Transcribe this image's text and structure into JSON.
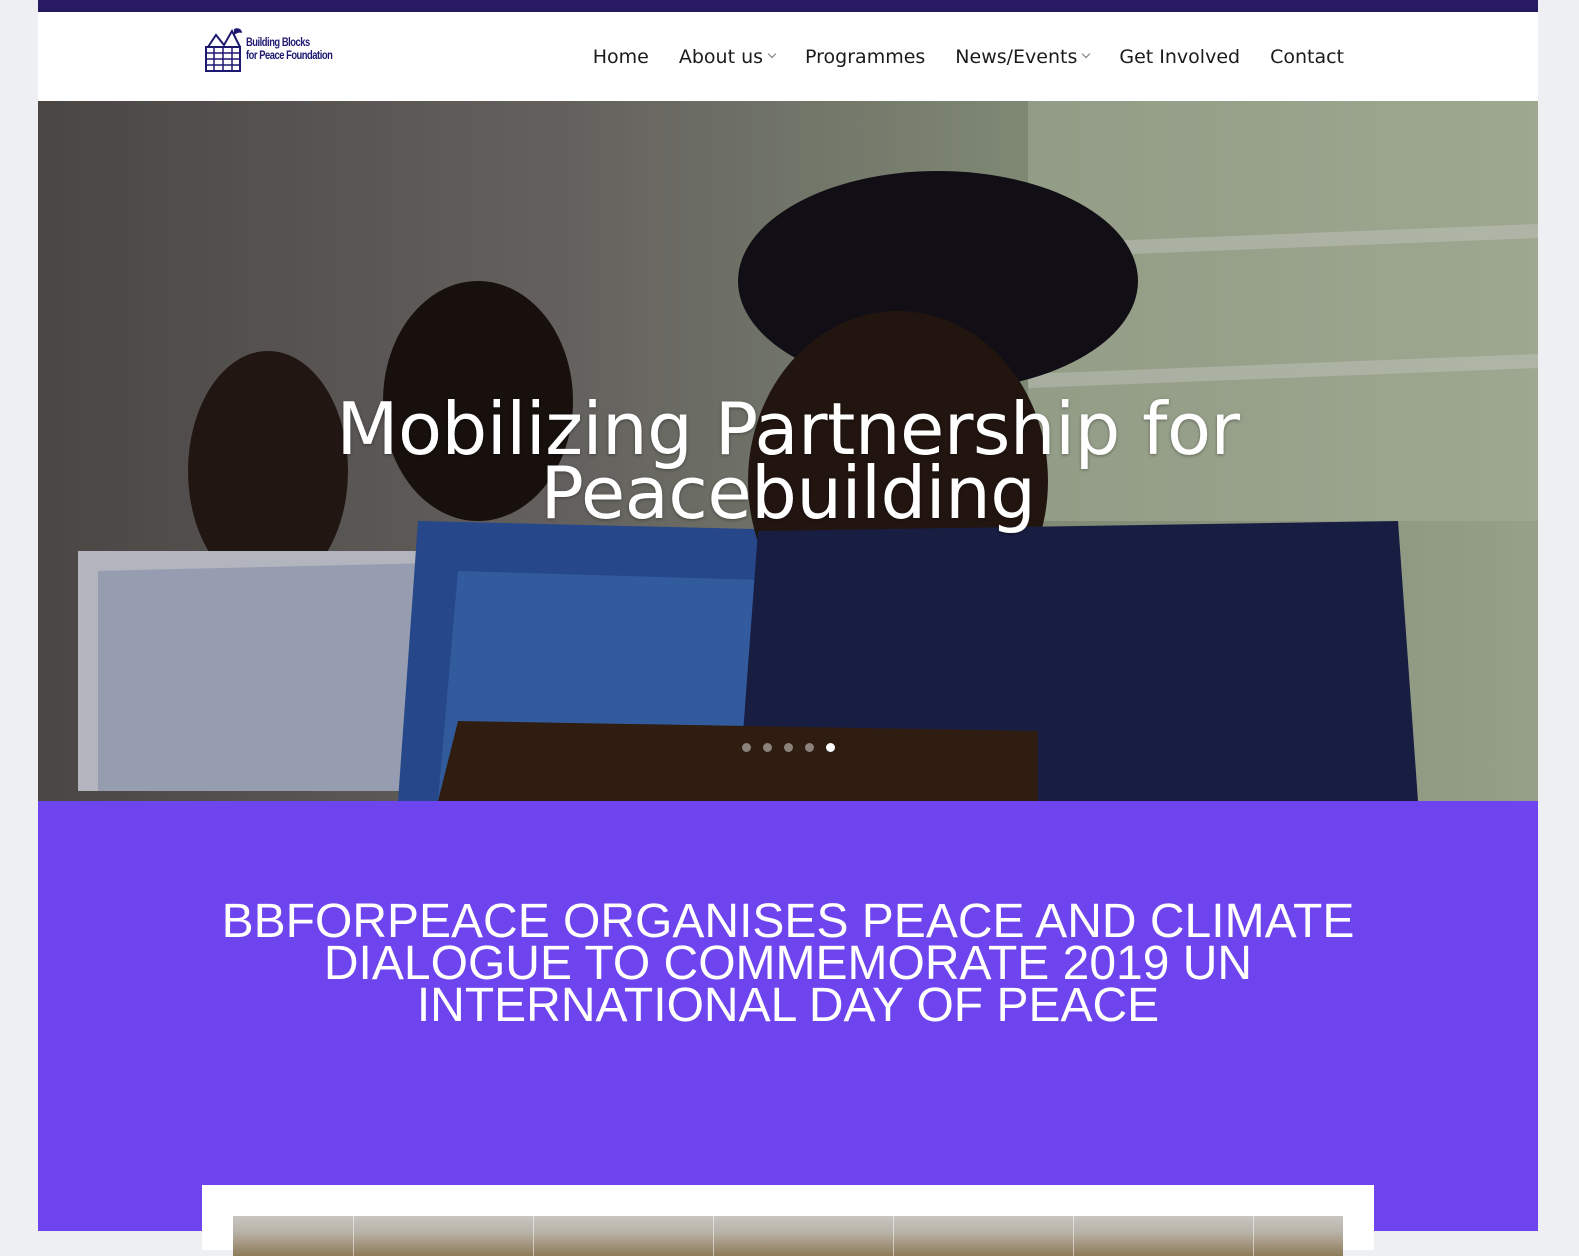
{
  "brand": {
    "logo_line1": "Building Blocks",
    "logo_line2": "for Peace Foundation"
  },
  "nav": {
    "items": [
      {
        "label": "Home",
        "has_dropdown": false
      },
      {
        "label": "About us",
        "has_dropdown": true
      },
      {
        "label": "Programmes",
        "has_dropdown": false
      },
      {
        "label": "News/Events",
        "has_dropdown": true
      },
      {
        "label": "Get Involved",
        "has_dropdown": false
      },
      {
        "label": "Contact",
        "has_dropdown": false
      }
    ]
  },
  "hero": {
    "title_line1": "Mobilizing Partnership for",
    "title_line2": "Peacebuilding",
    "slide_count": 5,
    "active_slide": 5
  },
  "feature": {
    "title_line1": "BBFORPEACE ORGANISES PEACE AND CLIMATE",
    "title_line2": "DIALOGUE TO COMMEMORATE 2019 UN",
    "title_line3": "INTERNATIONAL DAY OF PEACE"
  },
  "colors": {
    "topbar": "#271a62",
    "band": "#6d44ed",
    "logo_text": "#1d1870"
  }
}
